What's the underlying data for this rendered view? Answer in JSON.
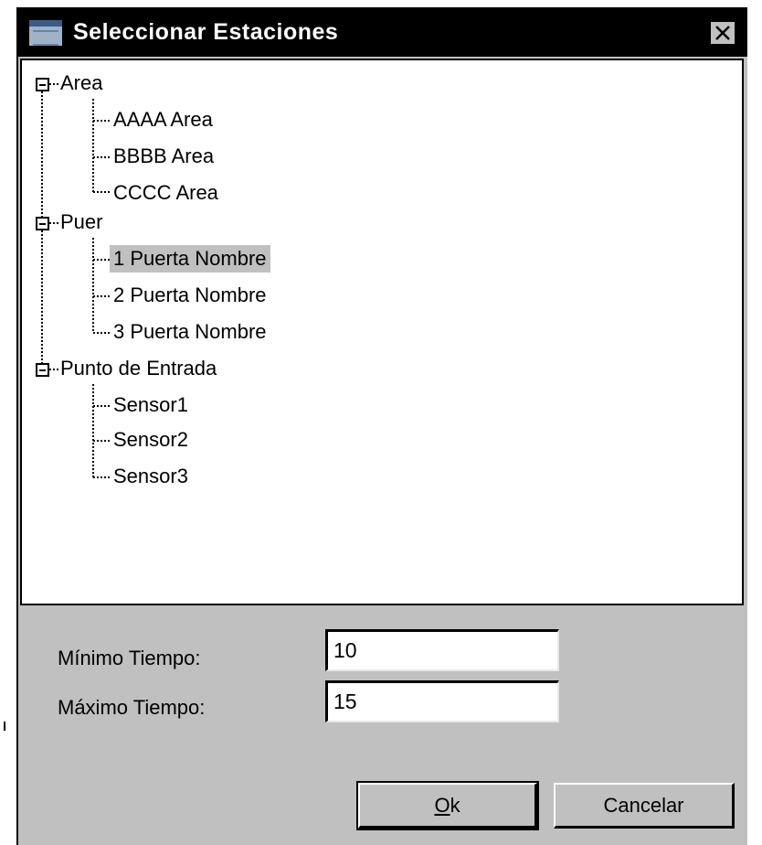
{
  "window": {
    "title": "Seleccionar Estaciones"
  },
  "tree": {
    "groups": [
      {
        "label": "Area",
        "children": [
          "AAAA Area",
          "BBBB Area",
          "CCCC Area"
        ]
      },
      {
        "label": "Puer",
        "children": [
          "1 Puerta Nombre",
          "2 Puerta Nombre",
          "3 Puerta Nombre"
        ]
      },
      {
        "label": "Punto de Entrada",
        "children": [
          "Sensor1",
          "Sensor2",
          "Sensor3"
        ]
      }
    ],
    "selected": "1 Puerta Nombre"
  },
  "form": {
    "min_label": "Mínimo Tiempo:",
    "min_value": "10",
    "max_label": "Máximo Tiempo:",
    "max_value": "15"
  },
  "buttons": {
    "ok_mnemonic": "O",
    "ok_rest": "k",
    "cancel": "Cancelar"
  }
}
